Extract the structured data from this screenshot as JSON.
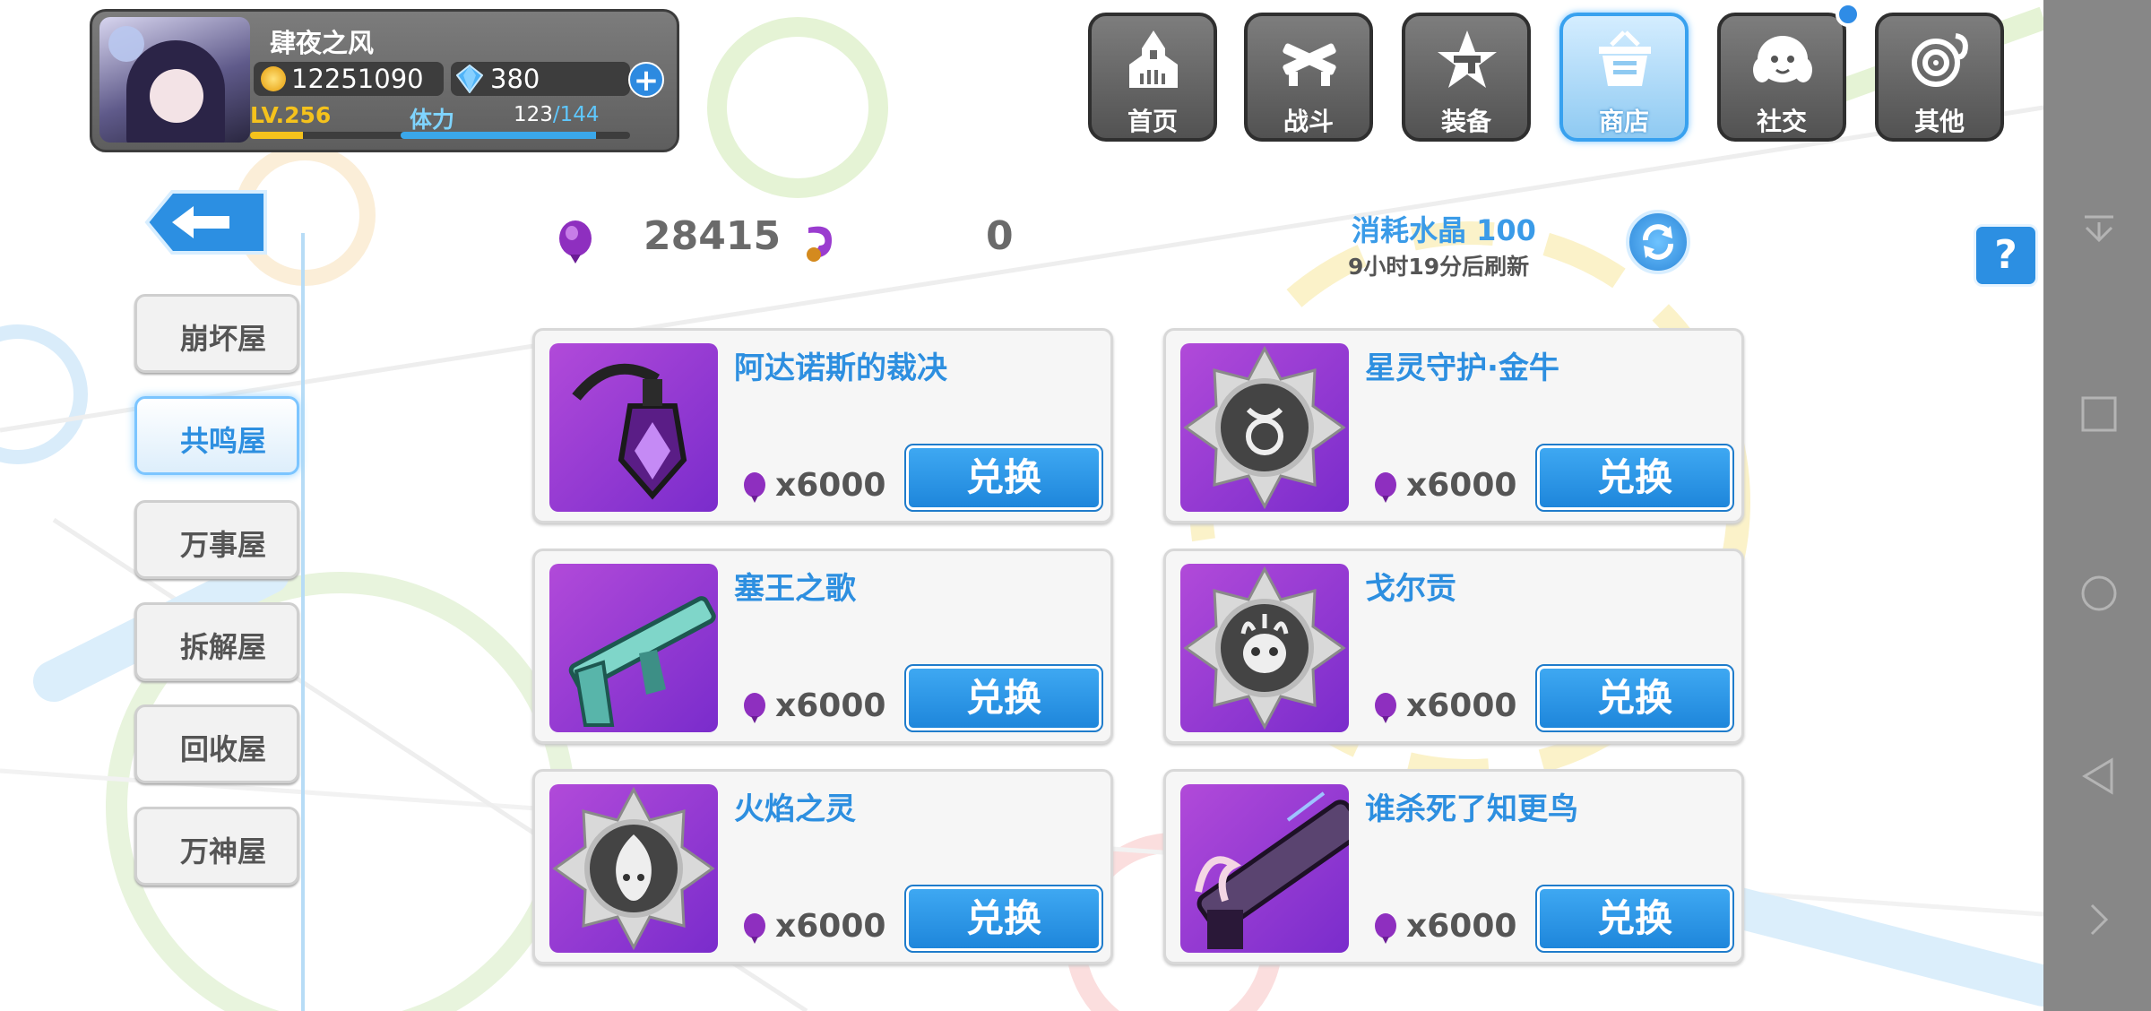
{
  "player": {
    "name": "肆夜之风",
    "gold": "12251090",
    "crystals": "380",
    "level": "LV.256",
    "level_progress": 0.25,
    "stamina_label": "体力",
    "stamina_current": "123",
    "stamina_max": "/144",
    "stamina_progress": 0.85
  },
  "nav": [
    {
      "label": "首页",
      "icon": "church-icon"
    },
    {
      "label": "战斗",
      "icon": "crossed-guns-icon"
    },
    {
      "label": "装备",
      "icon": "star-gun-icon"
    },
    {
      "label": "商店",
      "icon": "shopping-basket-icon",
      "active": true
    },
    {
      "label": "社交",
      "icon": "mascot-face-icon",
      "notification": true
    },
    {
      "label": "其他",
      "icon": "gear-ear-icon"
    }
  ],
  "sidebar": {
    "items": [
      {
        "label": "崩坏屋"
      },
      {
        "label": "共鸣屋",
        "active": true
      },
      {
        "label": "万事屋"
      },
      {
        "label": "拆解屋"
      },
      {
        "label": "回收屋"
      },
      {
        "label": "万神屋"
      }
    ]
  },
  "currency": {
    "resonance": "28415",
    "secondary": "0"
  },
  "refresh": {
    "cost": "消耗水晶 100",
    "time": "9小时19分后刷新"
  },
  "help_label": "?",
  "shop": {
    "items": [
      {
        "name": "阿达诺斯的裁决",
        "price": "x6000",
        "button": "兑换",
        "thumb": "scythe-weapon"
      },
      {
        "name": "星灵守护·金牛",
        "price": "x6000",
        "button": "兑换",
        "thumb": "taurus-badge"
      },
      {
        "name": "塞王之歌",
        "price": "x6000",
        "button": "兑换",
        "thumb": "siren-rifle"
      },
      {
        "name": "戈尔贡",
        "price": "x6000",
        "button": "兑换",
        "thumb": "gorgon-badge"
      },
      {
        "name": "火焰之灵",
        "price": "x6000",
        "button": "兑换",
        "thumb": "flame-spirit-badge"
      },
      {
        "name": "谁杀死了知更鸟",
        "price": "x6000",
        "button": "兑换",
        "thumb": "robin-gun"
      }
    ]
  },
  "colors": {
    "accent": "#2d8fe0",
    "gold": "#f5c21c",
    "thumb_purple": "#9b3bd4"
  }
}
